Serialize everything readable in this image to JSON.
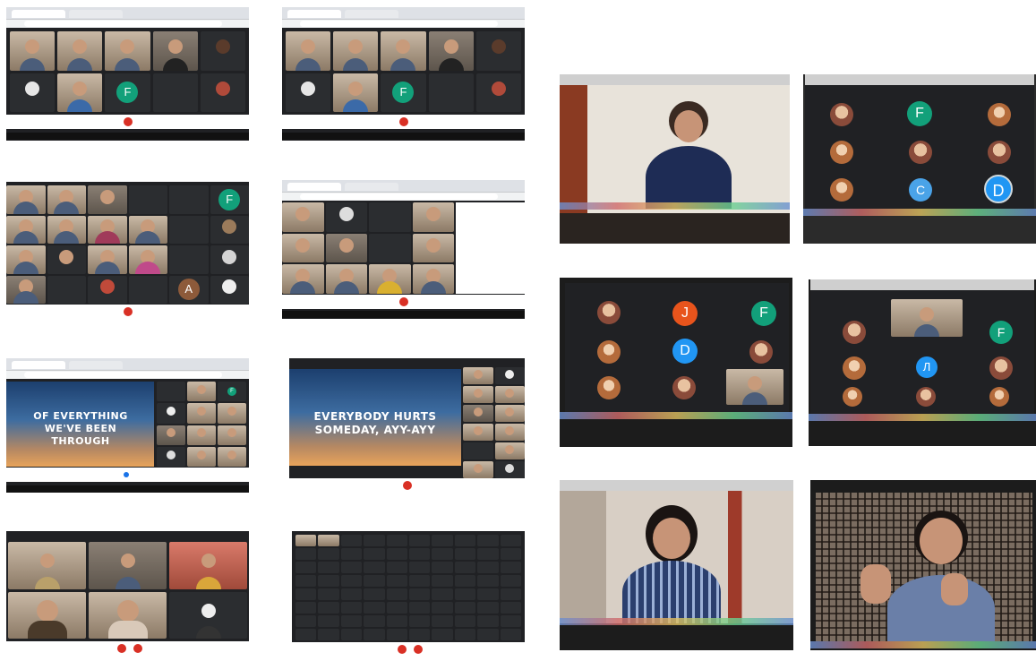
{
  "lyrics": {
    "line1": "OF EVERYTHING WE'VE BEEN THROUGH",
    "line2": "EVERYBODY HURTS SOMEDAY, AYY-AYY"
  },
  "avatars": {
    "f": "F",
    "j": "J",
    "d": "D",
    "c": "C",
    "a": "A",
    "l": "Л"
  },
  "colors": {
    "meet_dark": "#202124",
    "end_call_red": "#d93025",
    "avatar_teal": "#12a07a",
    "avatar_blue": "#2196f3",
    "avatar_orange": "#e8541c",
    "avatar_brown": "#8d5a3a"
  }
}
